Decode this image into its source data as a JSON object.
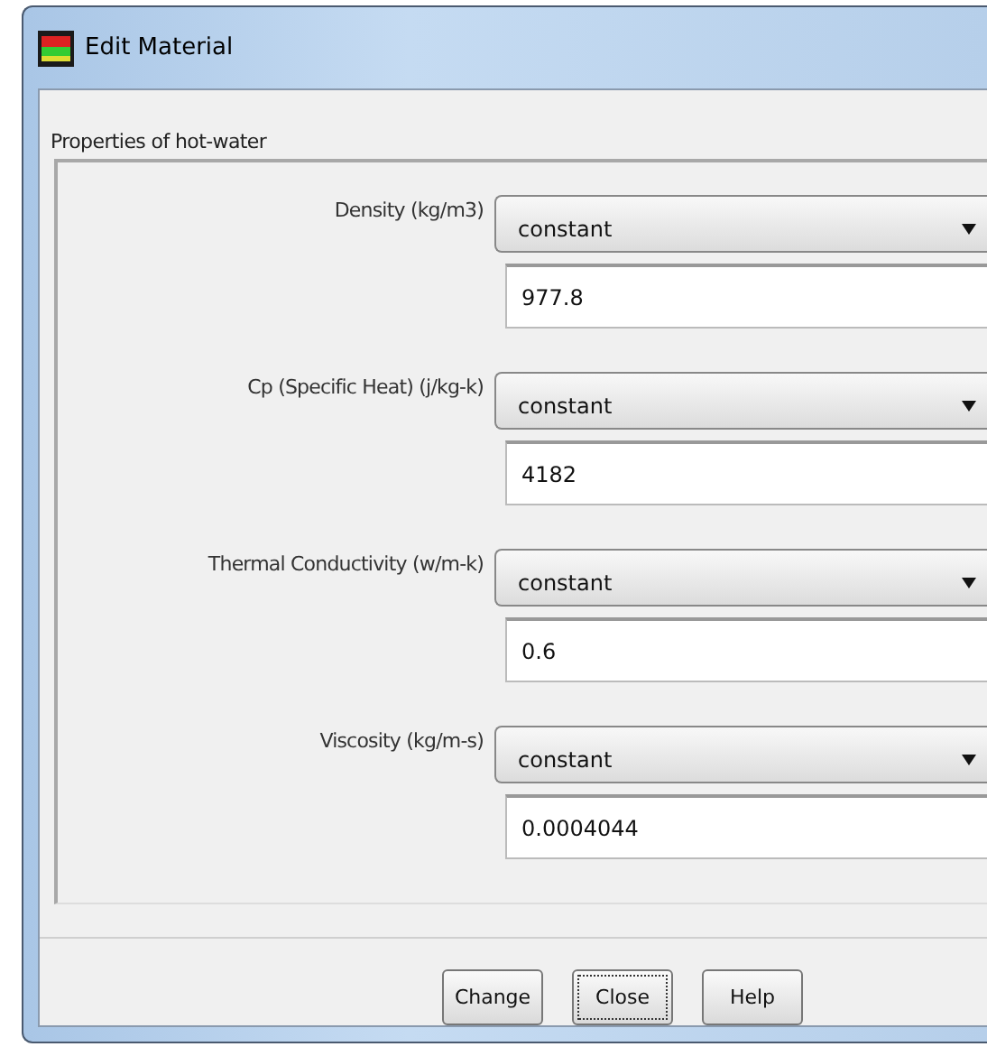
{
  "window": {
    "title": "Edit Material"
  },
  "group": {
    "title": "Properties of hot-water"
  },
  "properties": [
    {
      "label": "Density (kg/m3)",
      "method": "constant",
      "value": "977.8"
    },
    {
      "label": "Cp (Specific Heat) (j/kg-k)",
      "method": "constant",
      "value": "4182"
    },
    {
      "label": "Thermal Conductivity (w/m-k)",
      "method": "constant",
      "value": "0.6"
    },
    {
      "label": "Viscosity (kg/m-s)",
      "method": "constant",
      "value": "0.0004044"
    }
  ],
  "buttons": [
    {
      "label": "Change",
      "focused": false
    },
    {
      "label": "Close",
      "focused": true
    },
    {
      "label": "Help",
      "focused": false
    }
  ]
}
